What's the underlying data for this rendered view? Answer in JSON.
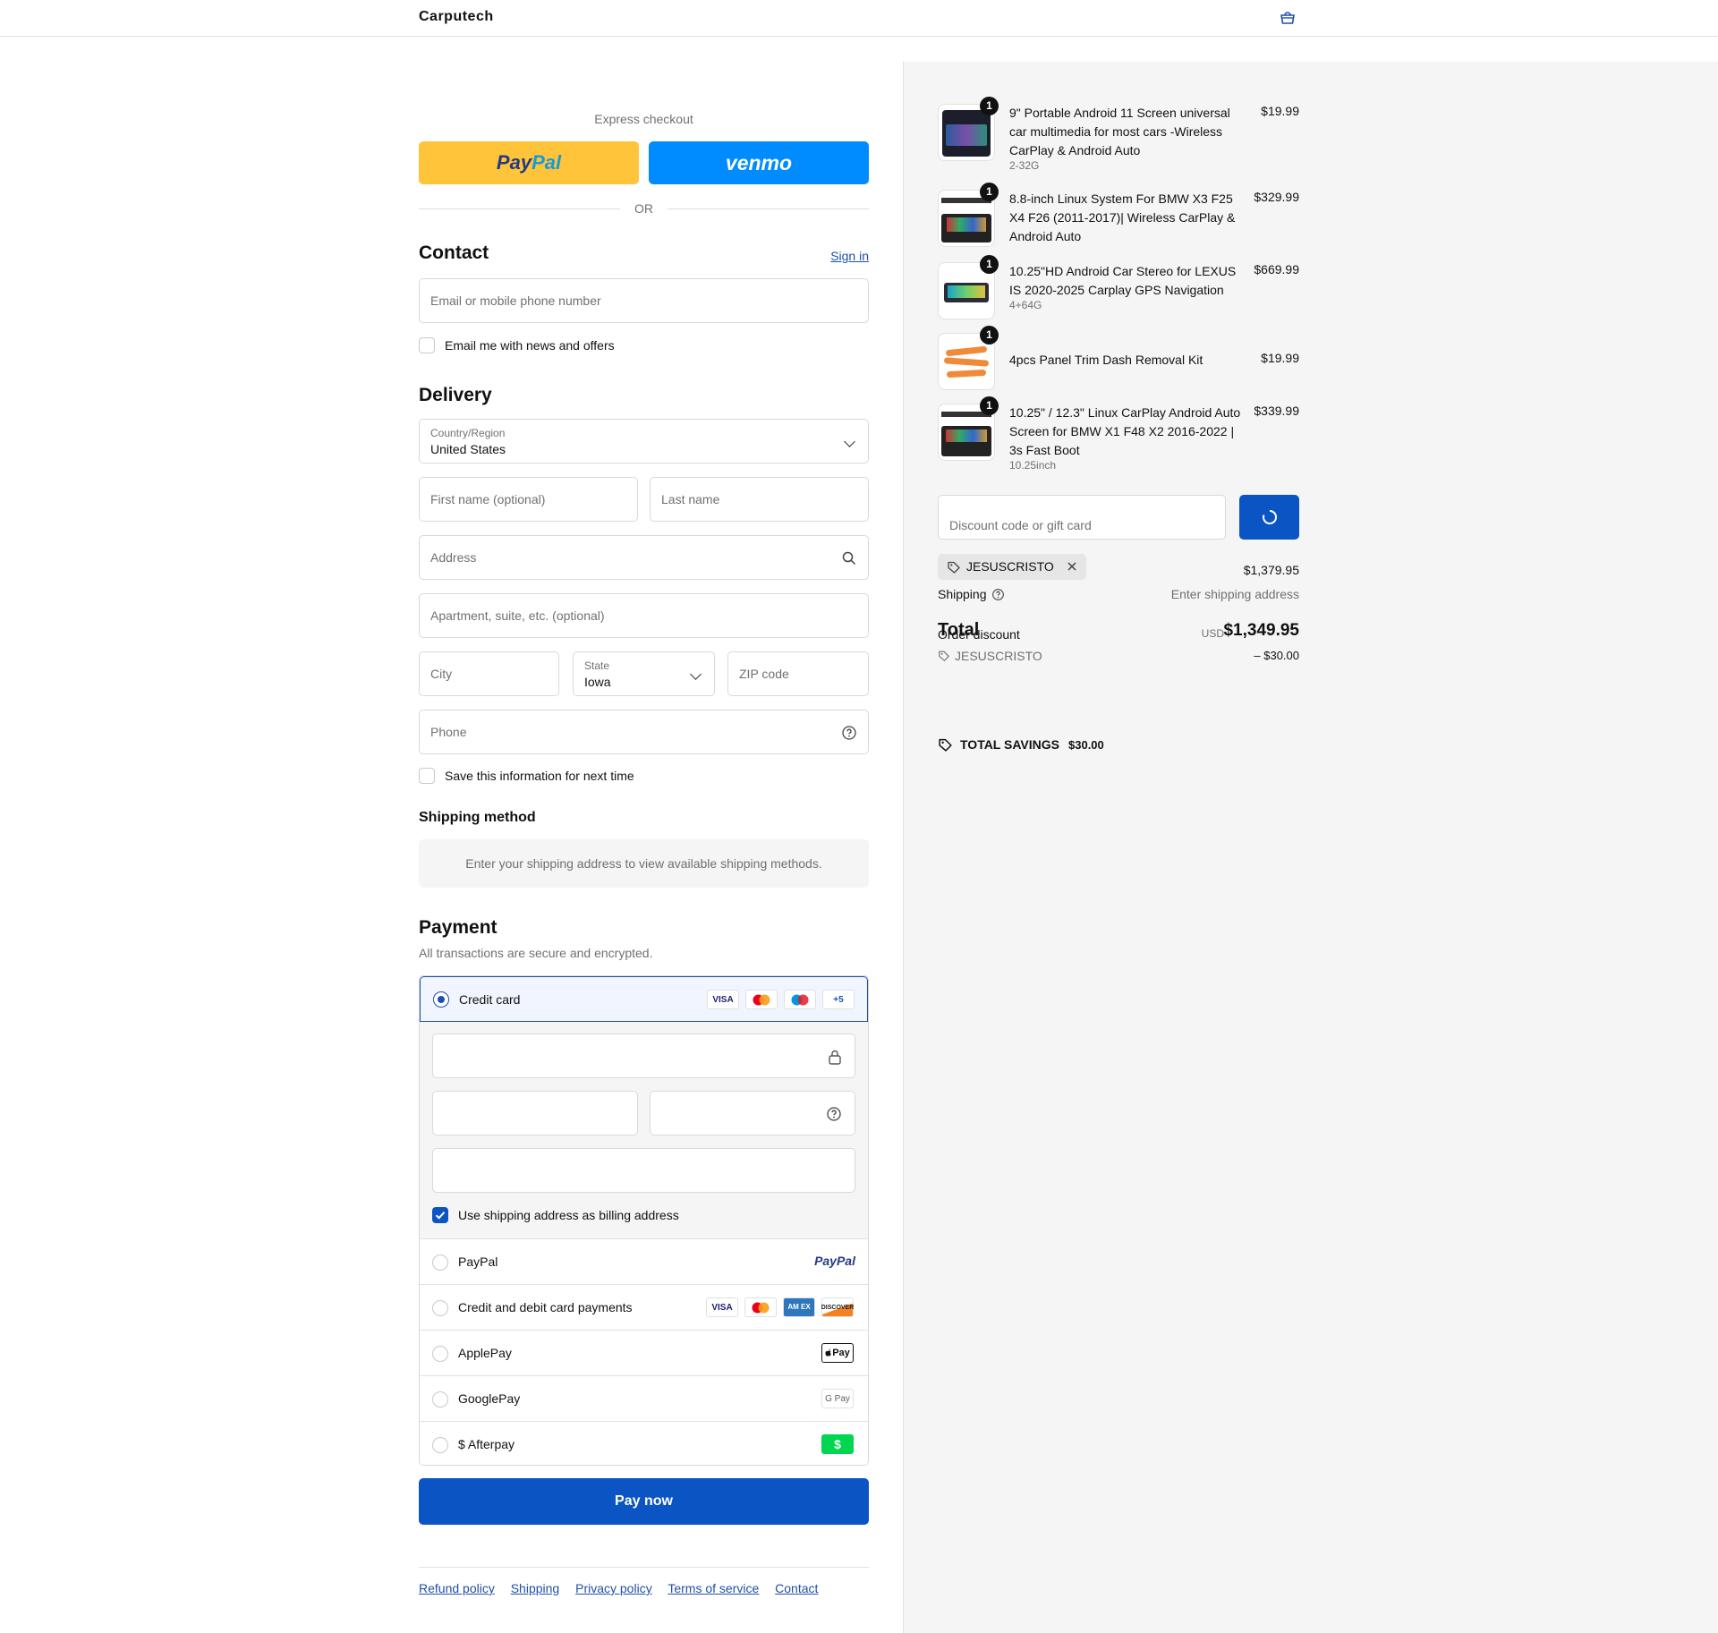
{
  "header": {
    "brand": "Carputech",
    "cart_icon": "cart-icon"
  },
  "express": {
    "label": "Express checkout",
    "paypal_part1": "Pay",
    "paypal_part2": "Pal",
    "venmo": "venmo",
    "or": "OR"
  },
  "contact": {
    "title": "Contact",
    "sign_in": "Sign in",
    "email_placeholder": "Email or mobile phone number",
    "newsletter_label": "Email me with news and offers"
  },
  "delivery": {
    "title": "Delivery",
    "country_label": "Country/Region",
    "country_value": "United States",
    "first_name_placeholder": "First name (optional)",
    "last_name_placeholder": "Last name",
    "address_placeholder": "Address",
    "apartment_placeholder": "Apartment, suite, etc. (optional)",
    "city_placeholder": "City",
    "state_label": "State",
    "state_value": "Iowa",
    "zip_placeholder": "ZIP code",
    "phone_placeholder": "Phone",
    "save_info_label": "Save this information for next time"
  },
  "shipping_method": {
    "title": "Shipping method",
    "message": "Enter your shipping address to view available shipping methods."
  },
  "payment": {
    "title": "Payment",
    "subtitle": "All transactions are secure and encrypted.",
    "credit_card_label": "Credit card",
    "card_badges": [
      "VISA",
      "+5"
    ],
    "billing_label": "Use shipping address as billing address",
    "options": [
      {
        "label": "PayPal",
        "badge": "PayPal"
      },
      {
        "label": "Credit and debit card payments",
        "badges": [
          "VISA",
          "AM EX",
          "DISCOVER"
        ]
      },
      {
        "label": "ApplePay",
        "badge": "Pay"
      },
      {
        "label": "GooglePay",
        "badge": "G Pay"
      },
      {
        "label": "$ Afterpay",
        "badge": "$"
      }
    ],
    "pay_now": "Pay now"
  },
  "footer": {
    "links": [
      "Refund policy",
      "Shipping",
      "Privacy policy",
      "Terms of service",
      "Contact"
    ]
  },
  "order": {
    "items": [
      {
        "qty": "1",
        "name": "9\" Portable Android 11 Screen universal car multimedia for most cars -Wireless CarPlay & Android Auto",
        "variant": "2-32G",
        "price": "$19.99"
      },
      {
        "qty": "1",
        "name": "8.8-inch Linux System For BMW X3 F25 X4 F26 (2011-2017)| Wireless CarPlay & Android Auto",
        "variant": "",
        "price": "$329.99"
      },
      {
        "qty": "1",
        "name": "10.25\"HD Android Car Stereo for LEXUS IS 2020-2025 Carplay GPS Navigation",
        "variant": "4+64G",
        "price": "$669.99"
      },
      {
        "qty": "1",
        "name": "4pcs Panel Trim Dash Removal Kit",
        "variant": "",
        "price": "$19.99"
      },
      {
        "qty": "1",
        "name": "10.25\" / 12.3\" Linux CarPlay Android Auto Screen for BMW X1 F48 X2 2016-2022 | 3s Fast Boot",
        "variant": "10.25inch",
        "price": "$339.99"
      }
    ],
    "discount_placeholder": "Discount code or gift card",
    "applied_code": "JESUSCRISTO",
    "subtotal": "$1,379.95",
    "shipping_label": "Shipping",
    "shipping_value": "Enter shipping address",
    "total_label": "Total",
    "order_discount_label": "Order discount",
    "currency": "USD",
    "total": "$1,349.95",
    "discount_code": "JESUSCRISTO",
    "discount_amount": "– $30.00",
    "savings_label": "TOTAL SAVINGS",
    "savings_amount": "$30.00"
  },
  "colors": {
    "accent": "#0a54c3",
    "paypal": "#ffc439",
    "venmo": "#008cff",
    "link": "#1f4fad"
  }
}
